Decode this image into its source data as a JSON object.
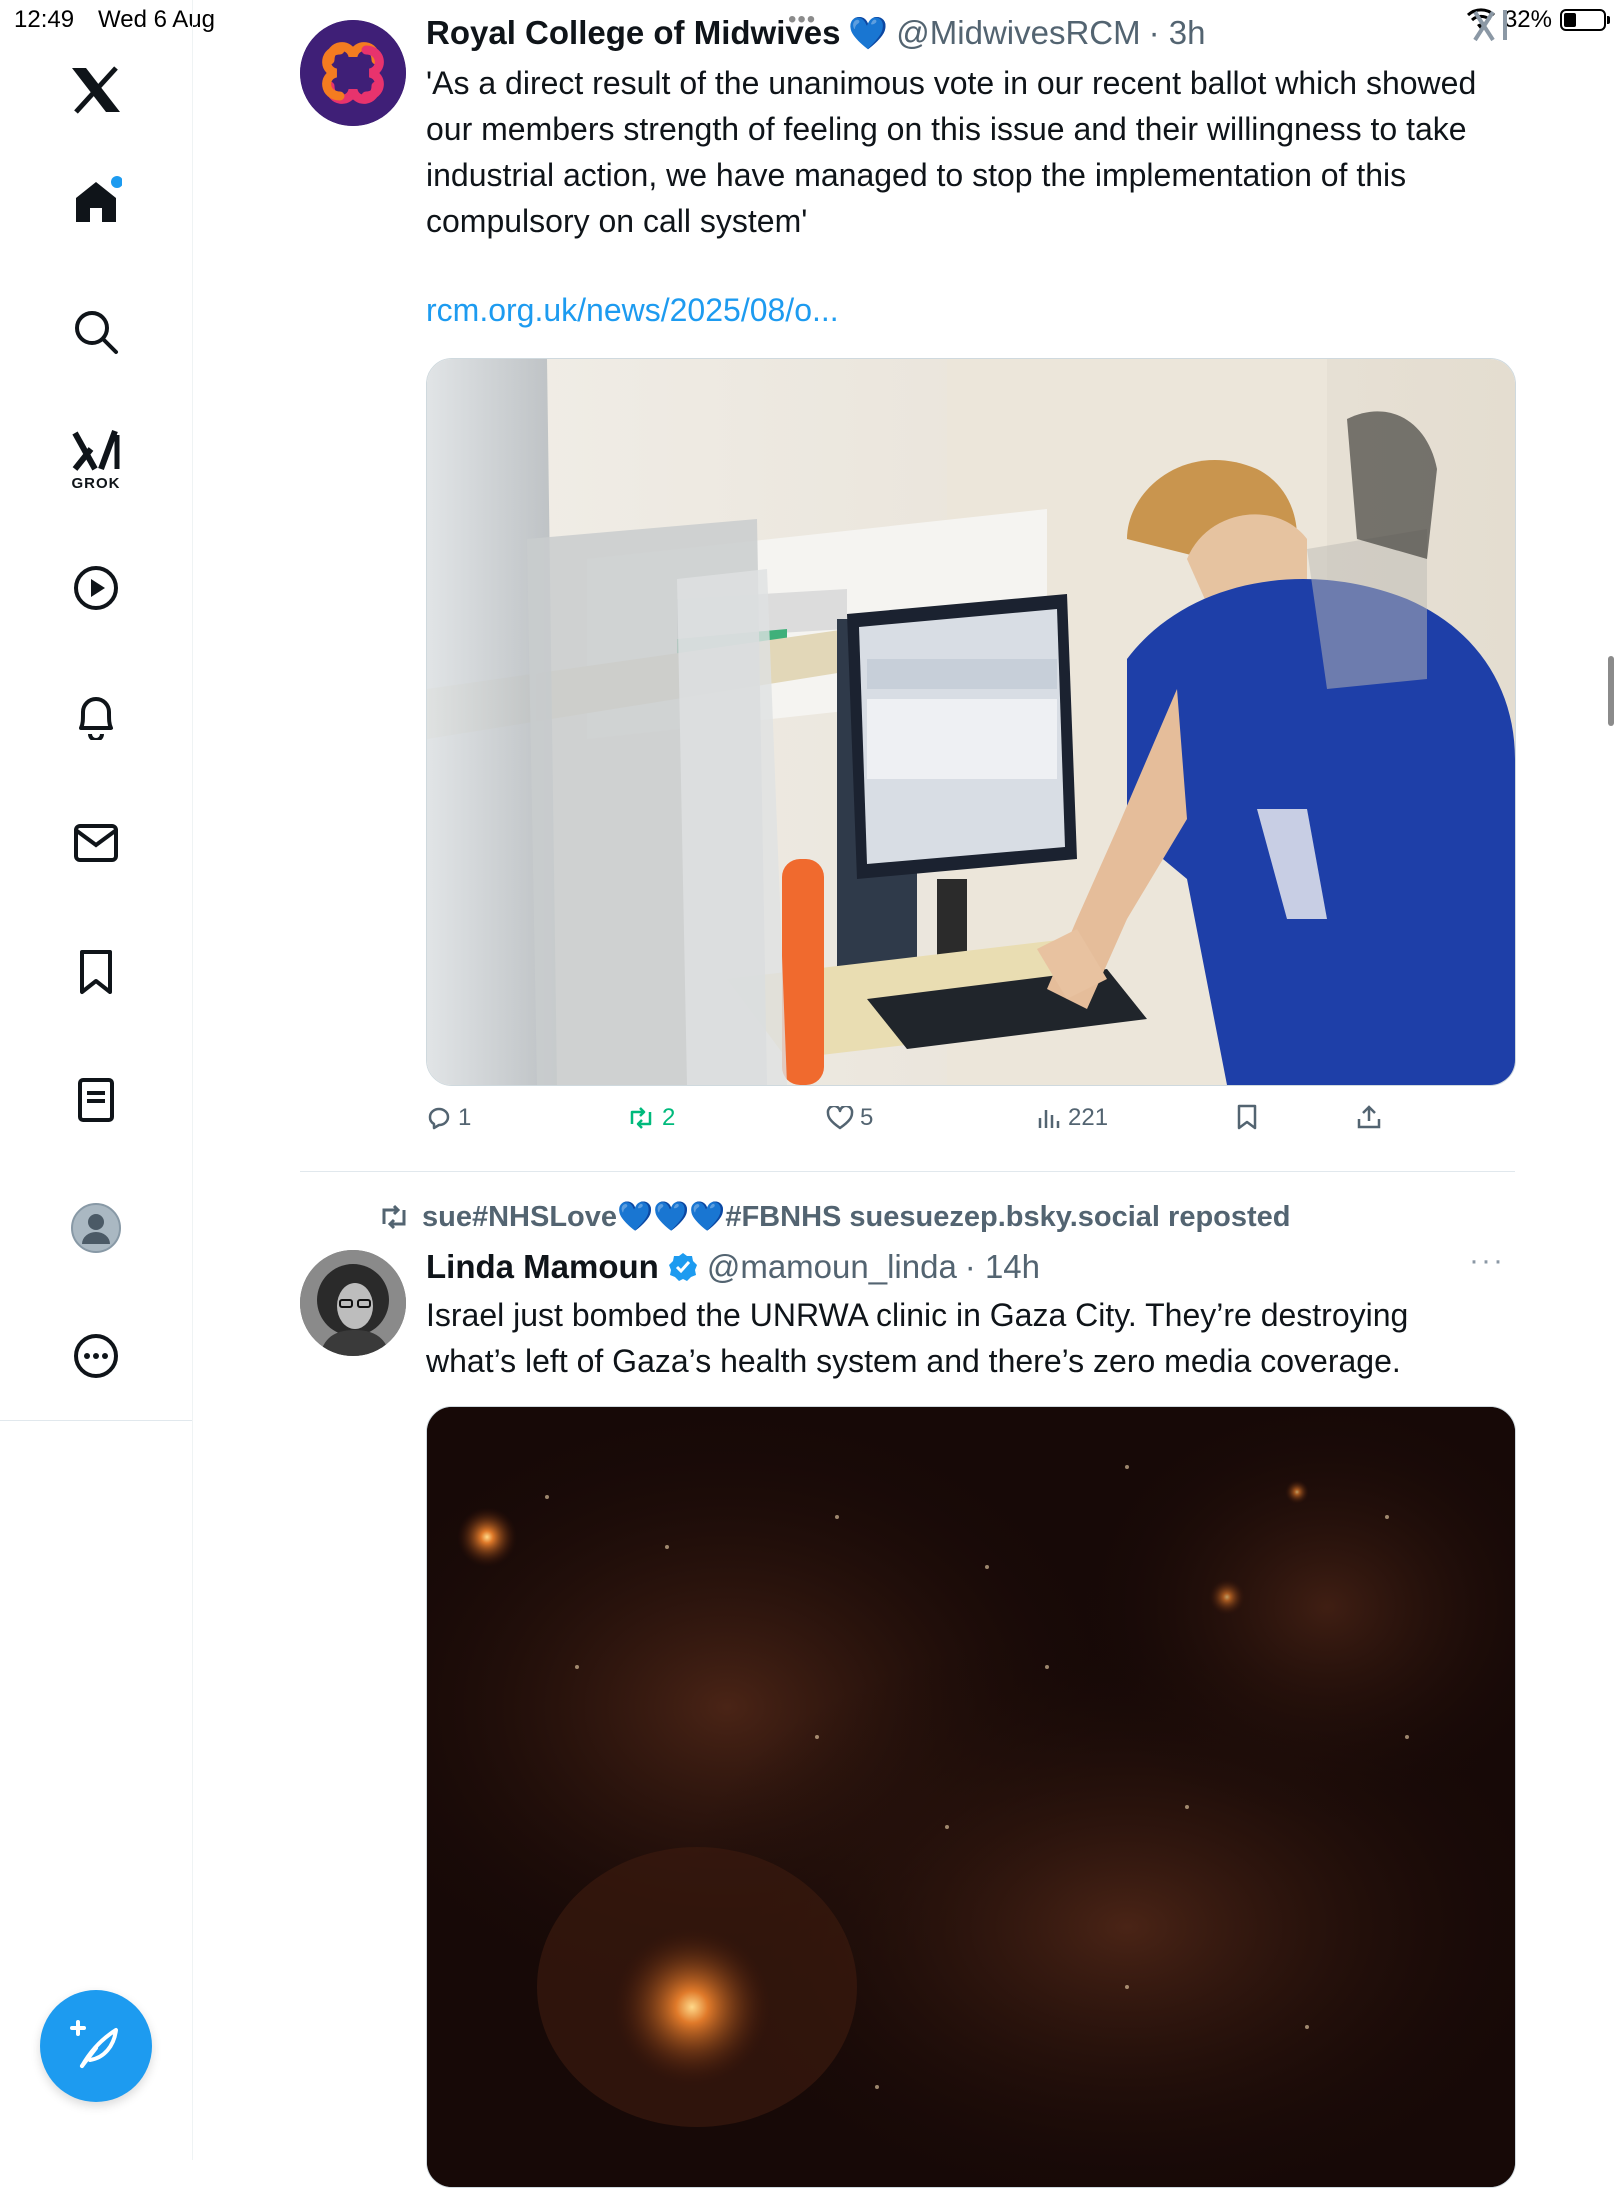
{
  "status_bar": {
    "time": "12:49",
    "date": "Wed 6 Aug",
    "battery_percent": "32%",
    "battery_level": 0.32
  },
  "sidebar": {
    "items": [
      {
        "icon": "x-logo-icon"
      },
      {
        "icon": "home-icon",
        "has_notification_dot": true
      },
      {
        "icon": "search-icon"
      },
      {
        "icon": "grok-icon",
        "label": "GROK"
      },
      {
        "icon": "play-icon"
      },
      {
        "icon": "bell-icon"
      },
      {
        "icon": "mail-icon"
      },
      {
        "icon": "bookmark-icon"
      },
      {
        "icon": "list-icon"
      },
      {
        "icon": "profile-icon"
      },
      {
        "icon": "more-circle-icon"
      }
    ],
    "compose_icon": "compose-icon"
  },
  "posts": [
    {
      "author": "Royal College of Midwives",
      "badge": "💙",
      "handle": "@MidwivesRCM",
      "time": "· 3h",
      "text": "'As a direct result of the unanimous vote in our recent ballot which showed our members strength of feeling on this issue and their willingness to take industrial action, we have managed to stop the implementation of this compulsory on call system'",
      "link": "rcm.org.uk/news/2025/08/o...",
      "stats": {
        "replies": "1",
        "reposts": "2",
        "likes": "5",
        "views": "221"
      },
      "colors": {
        "repost": "#00ba7c",
        "link": "#1d9bf0"
      }
    },
    {
      "repost_by": "sue#NHSLove💙💙💙#FBNHS suesuezep.bsky.social reposted",
      "author": "Linda Mamoun",
      "verified": true,
      "handle": "@mamoun_linda",
      "time": "· 14h",
      "text": "Israel just bombed the UNRWA clinic in Gaza City. They’re destroying what’s left of Gaza’s health system and there’s zero media coverage.",
      "colors": {
        "verified": "#1d9bf0"
      }
    }
  ]
}
